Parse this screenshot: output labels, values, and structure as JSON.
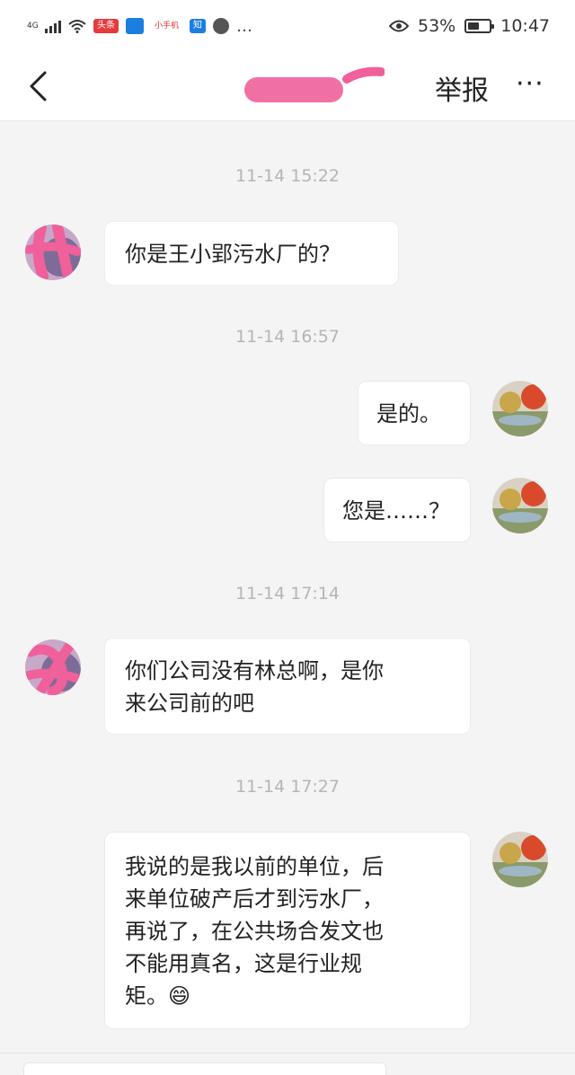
{
  "status_bar": {
    "network_label": "4G",
    "apps": [
      "头条",
      "",
      "小手机",
      "知",
      ""
    ],
    "more_icon": "…",
    "battery_percent": "53%",
    "battery_level": 0.53,
    "time": "10:47"
  },
  "header": {
    "title": "",
    "report_label": "举报",
    "more_label": "···"
  },
  "messages": [
    {
      "type": "time",
      "text": "11-14 15:22"
    },
    {
      "type": "msg",
      "side": "left",
      "text": "你是王小郢污水厂的？"
    },
    {
      "type": "time",
      "text": "11-14 16:57"
    },
    {
      "type": "msg",
      "side": "right",
      "text": "是的。"
    },
    {
      "type": "msg",
      "side": "right",
      "text": "您是……？"
    },
    {
      "type": "time",
      "text": "11-14 17:14"
    },
    {
      "type": "msg",
      "side": "left",
      "lines": [
        "你们公司没有林总啊，是你",
        "来公司前的吧"
      ]
    },
    {
      "type": "time",
      "text": "11-14 17:27"
    },
    {
      "type": "msg",
      "side": "right",
      "lines": [
        "我说的是我以前的单位，后",
        "来单位破产后才到污水厂，",
        "再说了，在公共场合发文也",
        "不能用真名，这是行业规",
        "矩。😄"
      ]
    }
  ],
  "colors": {
    "background": "#f4f4f4",
    "bubble": "#ffffff",
    "timestamp": "#b5b5b5",
    "redaction": "#f0609a"
  }
}
